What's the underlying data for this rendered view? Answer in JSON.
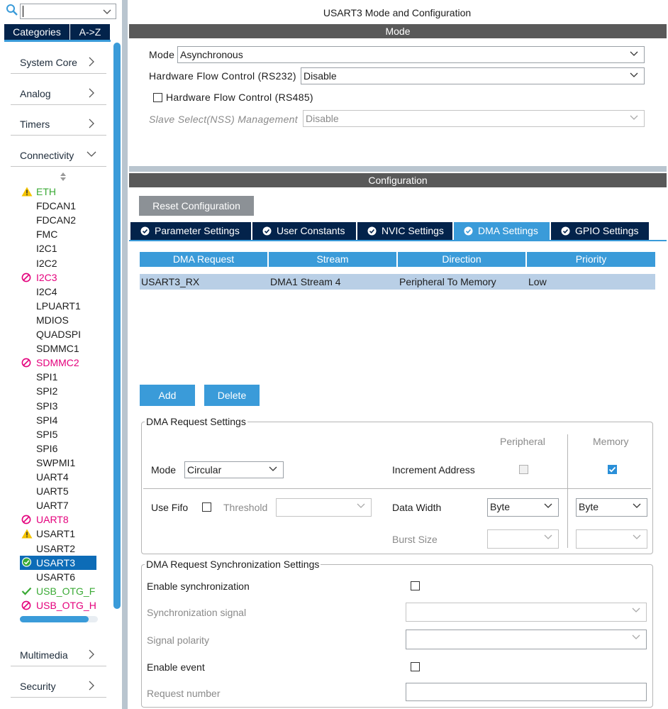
{
  "search": {
    "value": ""
  },
  "left_tabs": {
    "categories": "Categories",
    "az": "A->Z"
  },
  "categories": {
    "system_core": "System Core",
    "analog": "Analog",
    "timers": "Timers",
    "connectivity": "Connectivity",
    "multimedia": "Multimedia",
    "security": "Security"
  },
  "peripherals": [
    {
      "label": "ETH",
      "status": "warning"
    },
    {
      "label": "FDCAN1",
      "status": ""
    },
    {
      "label": "FDCAN2",
      "status": ""
    },
    {
      "label": "FMC",
      "status": ""
    },
    {
      "label": "I2C1",
      "status": ""
    },
    {
      "label": "I2C2",
      "status": ""
    },
    {
      "label": "I2C3",
      "status": "disabled"
    },
    {
      "label": "I2C4",
      "status": ""
    },
    {
      "label": "LPUART1",
      "status": ""
    },
    {
      "label": "MDIOS",
      "status": ""
    },
    {
      "label": "QUADSPI",
      "status": ""
    },
    {
      "label": "SDMMC1",
      "status": ""
    },
    {
      "label": "SDMMC2",
      "status": "disabled"
    },
    {
      "label": "SPI1",
      "status": ""
    },
    {
      "label": "SPI2",
      "status": ""
    },
    {
      "label": "SPI3",
      "status": ""
    },
    {
      "label": "SPI4",
      "status": ""
    },
    {
      "label": "SPI5",
      "status": ""
    },
    {
      "label": "SPI6",
      "status": ""
    },
    {
      "label": "SWPMI1",
      "status": ""
    },
    {
      "label": "UART4",
      "status": ""
    },
    {
      "label": "UART5",
      "status": ""
    },
    {
      "label": "UART7",
      "status": ""
    },
    {
      "label": "UART8",
      "status": "disabled"
    },
    {
      "label": "USART1",
      "status": "warning"
    },
    {
      "label": "USART2",
      "status": ""
    },
    {
      "label": "USART3",
      "status": "selected"
    },
    {
      "label": "USART6",
      "status": ""
    },
    {
      "label": "USB_OTG_F",
      "status": "ok"
    },
    {
      "label": "USB_OTG_H",
      "status": "disabled"
    }
  ],
  "main": {
    "title": "USART3 Mode and Configuration",
    "mode_header": "Mode",
    "config_header": "Configuration"
  },
  "mode": {
    "mode_label": "Mode",
    "mode_value": "Asynchronous",
    "hfc232_label": "Hardware Flow Control (RS232)",
    "hfc232_value": "Disable",
    "hfc485_label": "Hardware Flow Control (RS485)",
    "nss_label": "Slave Select(NSS) Management",
    "nss_value": "Disable"
  },
  "config": {
    "reset_label": "Reset Configuration",
    "tabs": [
      "Parameter Settings",
      "User Constants",
      "NVIC Settings",
      "DMA Settings",
      "GPIO Settings"
    ],
    "active_tab": "DMA Settings"
  },
  "dma_table": {
    "headers": [
      "DMA Request",
      "Stream",
      "Direction",
      "Priority"
    ],
    "rows": [
      [
        "USART3_RX",
        "DMA1 Stream 4",
        "Peripheral To Memory",
        "Low"
      ]
    ]
  },
  "buttons": {
    "add": "Add",
    "delete": "Delete"
  },
  "dma_request_settings": {
    "legend": "DMA Request Settings",
    "peripheral_col": "Peripheral",
    "memory_col": "Memory",
    "mode_label": "Mode",
    "mode_value": "Circular",
    "increment_label": "Increment Address",
    "peripheral_increment": false,
    "memory_increment": true,
    "use_fifo_label": "Use Fifo",
    "threshold_label": "Threshold",
    "threshold_value": "",
    "data_width_label": "Data Width",
    "peripheral_width": "Byte",
    "memory_width": "Byte",
    "burst_label": "Burst Size"
  },
  "sync_settings": {
    "legend": "DMA Request Synchronization Settings",
    "enable_sync_label": "Enable synchronization",
    "sync_signal_label": "Synchronization signal",
    "signal_polarity_label": "Signal polarity",
    "enable_event_label": "Enable event",
    "request_number_label": "Request number"
  },
  "colors": {
    "navy": "#03234b",
    "accent": "#3a9bd9",
    "header_gray": "#595959",
    "ok_green": "#3aaa35",
    "error_pink": "#e4007c",
    "warning_yellow": "#f5c400"
  }
}
